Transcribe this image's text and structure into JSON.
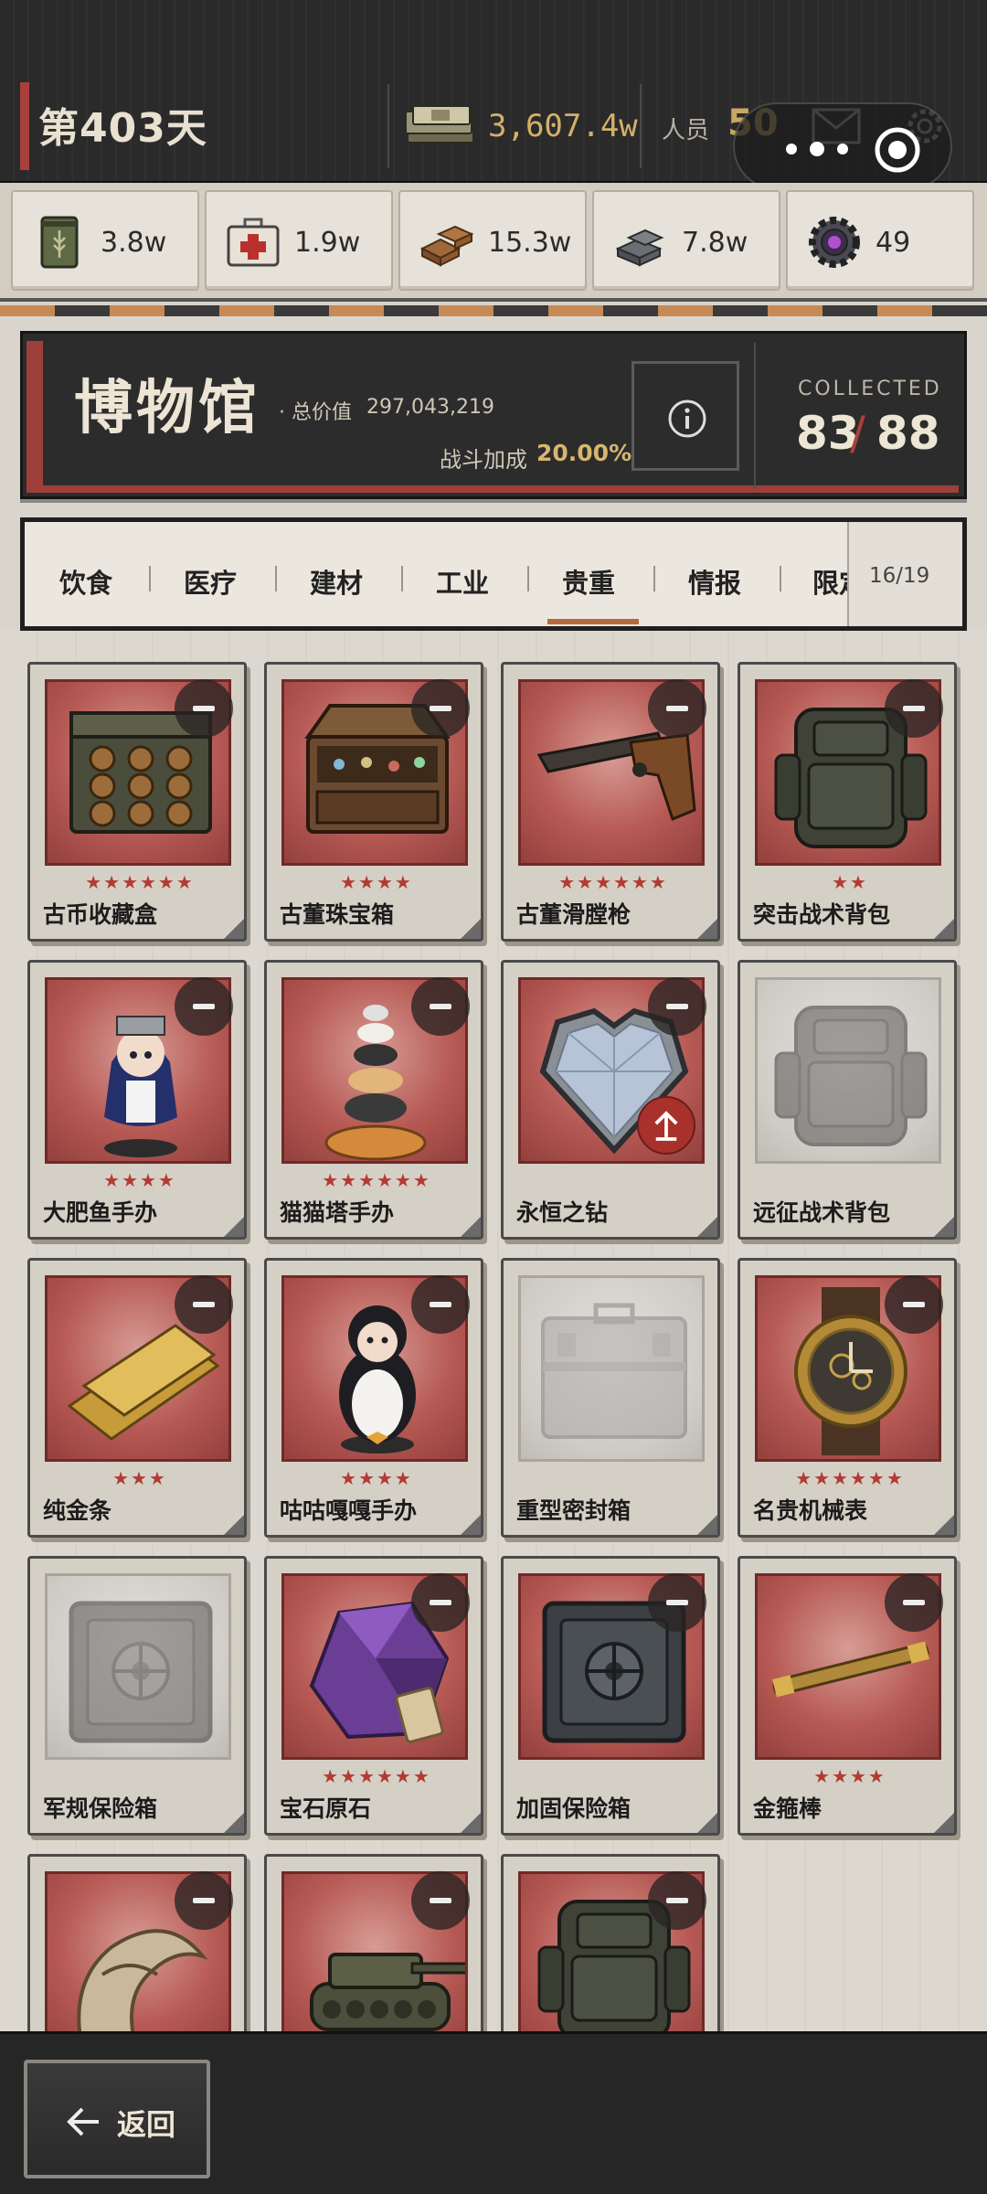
{
  "header": {
    "day_label": "第403天",
    "cash": "3,607.4w",
    "staff_label": "人员",
    "staff_value": "50"
  },
  "resources": [
    {
      "icon": "food-can-icon",
      "value": "3.8w"
    },
    {
      "icon": "medkit-icon",
      "value": "1.9w"
    },
    {
      "icon": "wood-planks-icon",
      "value": "15.3w"
    },
    {
      "icon": "steel-ingots-icon",
      "value": "7.8w"
    },
    {
      "icon": "gear-chip-icon",
      "value": "49"
    }
  ],
  "museum": {
    "title": "博物馆",
    "total_label": "· 总价值",
    "total_value": "297,043,219",
    "bonus_label": "战斗加成",
    "bonus_value": "20.00%",
    "collected_label": "COLLECTED",
    "collected_count": "83",
    "collected_total": "88"
  },
  "tabs": {
    "items": [
      "饮食",
      "医疗",
      "建材",
      "工业",
      "贵重",
      "情报",
      "限定"
    ],
    "active": "贵重",
    "count": "16/19"
  },
  "items": [
    {
      "name": "古币收藏盒",
      "stars": "★★★★★★",
      "locked": false,
      "icon": "coin-box-icon"
    },
    {
      "name": "古董珠宝箱",
      "stars": "★★★★",
      "locked": false,
      "icon": "jewel-chest-icon"
    },
    {
      "name": "古董滑膛枪",
      "stars": "★★★★★★",
      "locked": false,
      "icon": "musket-icon"
    },
    {
      "name": "突击战术背包",
      "stars": "★★",
      "locked": false,
      "icon": "backpack-icon"
    },
    {
      "name": "大肥鱼手办",
      "stars": "★★★★",
      "locked": false,
      "icon": "maid-figure-icon"
    },
    {
      "name": "猫猫塔手办",
      "stars": "★★★★★★",
      "locked": false,
      "icon": "cat-tower-icon"
    },
    {
      "name": "永恒之钻",
      "stars": "",
      "locked": false,
      "icon": "diamond-icon",
      "upgrade": true
    },
    {
      "name": "远征战术背包",
      "stars": "",
      "locked": true,
      "icon": "backpack-icon"
    },
    {
      "name": "纯金条",
      "stars": "★★★",
      "locked": false,
      "icon": "gold-bar-icon"
    },
    {
      "name": "咕咕嘎嘎手办",
      "stars": "★★★★",
      "locked": false,
      "icon": "penguin-figure-icon"
    },
    {
      "name": "重型密封箱",
      "stars": "",
      "locked": true,
      "icon": "sealed-case-icon"
    },
    {
      "name": "名贵机械表",
      "stars": "★★★★★★",
      "locked": false,
      "icon": "watch-icon"
    },
    {
      "name": "军规保险箱",
      "stars": "",
      "locked": true,
      "icon": "safe-icon"
    },
    {
      "name": "宝石原石",
      "stars": "★★★★★★",
      "locked": false,
      "icon": "gemstone-icon"
    },
    {
      "name": "加固保险箱",
      "stars": "",
      "locked": false,
      "icon": "safe-icon"
    },
    {
      "name": "金箍棒",
      "stars": "★★★★",
      "locked": false,
      "icon": "golden-staff-icon"
    },
    {
      "name": "",
      "stars": "",
      "locked": false,
      "icon": "bone-claw-icon"
    },
    {
      "name": "",
      "stars": "",
      "locked": false,
      "icon": "tank-icon"
    },
    {
      "name": "",
      "stars": "",
      "locked": false,
      "icon": "backpack-icon"
    }
  ],
  "footer": {
    "back_label": "返回"
  }
}
